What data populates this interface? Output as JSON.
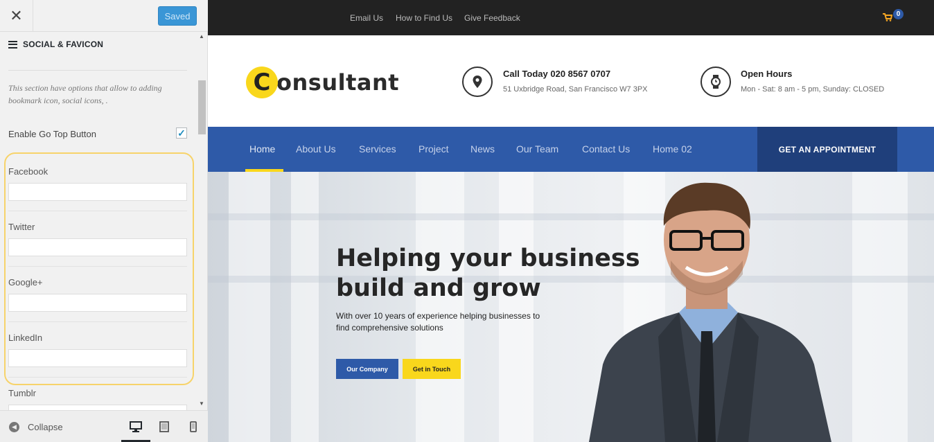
{
  "customizer": {
    "close_icon": "close-icon",
    "saved_label": "Saved",
    "section_title": "SOCIAL & FAVICON",
    "section_description": "This section have options that allow to adding bookmark icon, social icons, .",
    "go_top": {
      "label": "Enable Go Top Button",
      "checked": true
    },
    "fields": [
      {
        "label": "Facebook",
        "value": ""
      },
      {
        "label": "Twitter",
        "value": ""
      },
      {
        "label": "Google+",
        "value": ""
      },
      {
        "label": "LinkedIn",
        "value": ""
      },
      {
        "label": "Tumblr",
        "value": ""
      }
    ],
    "footer": {
      "collapse_label": "Collapse",
      "active_device": "desktop"
    },
    "colors": {
      "saved_button": "#3a96d6",
      "highlight": "#f7d36a"
    }
  },
  "site": {
    "top_links": [
      "Email Us",
      "How to Find Us",
      "Give Feedback"
    ],
    "cart_count": "0",
    "logo": {
      "initial": "C",
      "rest": "onsultant"
    },
    "contact": {
      "title": "Call Today 020 8567 0707",
      "subtitle": "51 Uxbridge Road, San Francisco W7 3PX"
    },
    "hours": {
      "title": "Open Hours",
      "subtitle": "Mon - Sat: 8 am - 5 pm, Sunday: CLOSED"
    },
    "nav": [
      "Home",
      "About Us",
      "Services",
      "Project",
      "News",
      "Our Team",
      "Contact Us",
      "Home 02"
    ],
    "nav_active": "Home",
    "cta_label": "GET AN APPOINTMENT",
    "hero": {
      "title": "Helping your business build and grow",
      "text": "With over 10 years of experience helping businesses to find comprehensive solutions",
      "primary_button": "Our Company",
      "secondary_button": "Get in Touch"
    },
    "colors": {
      "primary": "#2e5aa8",
      "accent": "#f9d71c",
      "dark": "#222222",
      "cta": "#1f3f7b"
    }
  }
}
